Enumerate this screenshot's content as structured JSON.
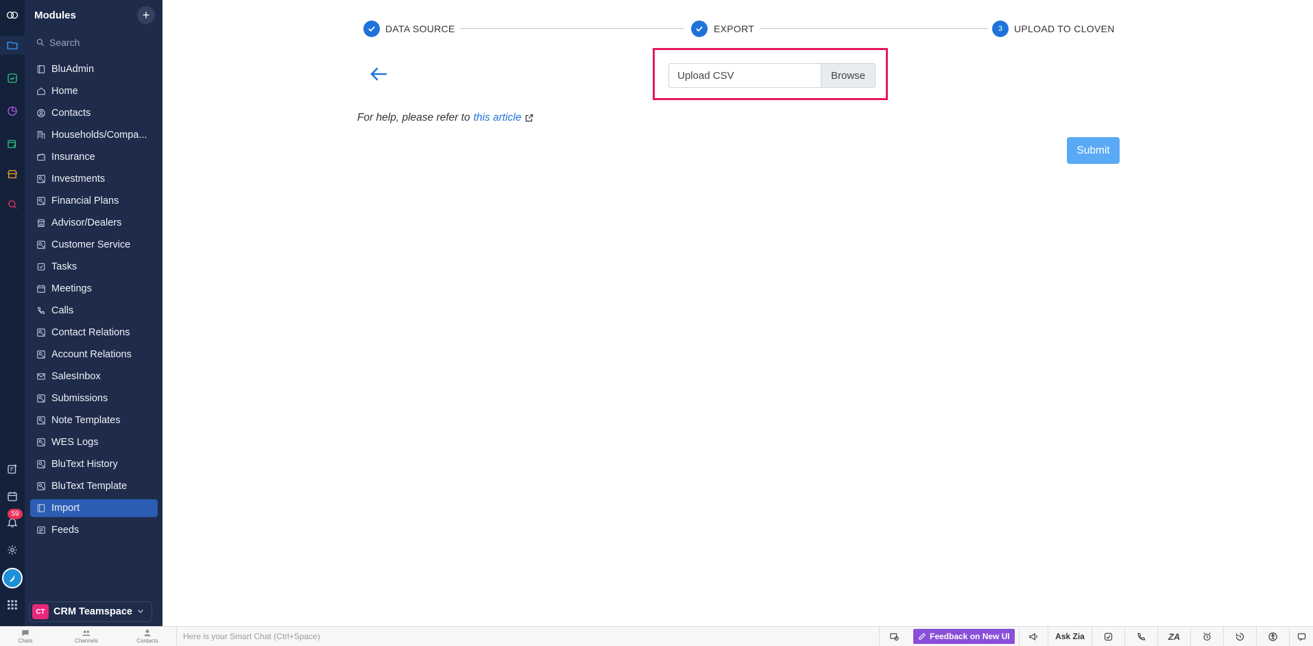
{
  "sidebar": {
    "title": "Modules",
    "search_placeholder": "Search",
    "items": [
      {
        "label": "BluAdmin",
        "icon": "module-icon"
      },
      {
        "label": "Home",
        "icon": "home-icon"
      },
      {
        "label": "Contacts",
        "icon": "contact-icon"
      },
      {
        "label": "Households/Compa...",
        "icon": "building-icon"
      },
      {
        "label": "Insurance",
        "icon": "wallet-icon"
      },
      {
        "label": "Investments",
        "icon": "custom-module-icon"
      },
      {
        "label": "Financial Plans",
        "icon": "custom-module-icon"
      },
      {
        "label": "Advisor/Dealers",
        "icon": "store-icon"
      },
      {
        "label": "Customer Service",
        "icon": "custom-module-icon"
      },
      {
        "label": "Tasks",
        "icon": "task-icon"
      },
      {
        "label": "Meetings",
        "icon": "calendar-icon"
      },
      {
        "label": "Calls",
        "icon": "phone-icon"
      },
      {
        "label": "Contact Relations",
        "icon": "custom-module-icon"
      },
      {
        "label": "Account Relations",
        "icon": "custom-module-icon"
      },
      {
        "label": "SalesInbox",
        "icon": "mail-icon"
      },
      {
        "label": "Submissions",
        "icon": "custom-module-icon"
      },
      {
        "label": "Note Templates",
        "icon": "custom-module-icon"
      },
      {
        "label": "WES Logs",
        "icon": "custom-module-icon"
      },
      {
        "label": "BluText History",
        "icon": "custom-module-icon"
      },
      {
        "label": "BluText Template",
        "icon": "custom-module-icon"
      },
      {
        "label": "Import",
        "icon": "module-icon",
        "active": true
      },
      {
        "label": "Feeds",
        "icon": "feeds-icon"
      }
    ],
    "teamspace": {
      "badge": "CT",
      "label": "CRM Teamspace"
    }
  },
  "rail": {
    "notification_count": "59"
  },
  "wizard": {
    "steps": [
      {
        "label": "DATA SOURCE",
        "state": "done"
      },
      {
        "label": "EXPORT",
        "state": "done"
      },
      {
        "label": "UPLOAD TO CLOVEN",
        "state": "current",
        "number": "3"
      }
    ]
  },
  "upload": {
    "input_label": "Upload CSV",
    "browse_label": "Browse"
  },
  "help": {
    "prefix": "For help, please refer to",
    "link_text": "this article"
  },
  "submit_label": "Submit",
  "bottombar": {
    "tabs": [
      "Chats",
      "Channels",
      "Contacts"
    ],
    "smartchat_placeholder": "Here is your Smart Chat (Ctrl+Space)",
    "feedback_label": "Feedback on New UI",
    "askzia_label": "Ask Zia"
  },
  "colors": {
    "sidebar_bg": "#1e2b4a",
    "rail_bg": "#14213b",
    "accent_blue": "#1e73d8",
    "highlight_border": "#e8175d",
    "submit_bg": "#5aa9f5",
    "feedback_bg": "#8a4fd8"
  }
}
